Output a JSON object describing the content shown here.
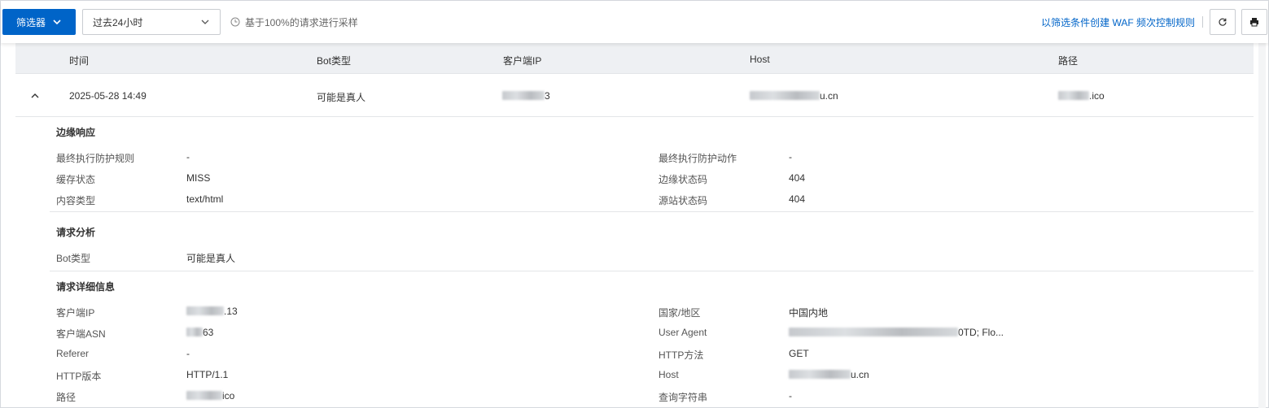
{
  "toolbar": {
    "filter_label": "筛选器",
    "time_range": "过去24小时",
    "sampling_note": "基于100%的请求进行采样",
    "waf_link": "以筛选条件创建 WAF 频次控制规则"
  },
  "table": {
    "columns": [
      "时间",
      "Bot类型",
      "客户端IP",
      "Host",
      "路径"
    ],
    "row": {
      "time": "2025-05-28 14:49",
      "bot_type": "可能是真人",
      "client_ip_suffix": "3",
      "host_suffix": "u.cn",
      "path_suffix": ".ico"
    }
  },
  "sections": {
    "edge": {
      "title": "边缘响应",
      "final_rule_label": "最终执行防护规则",
      "final_rule_value": "-",
      "final_action_label": "最终执行防护动作",
      "final_action_value": "-",
      "cache_label": "缓存状态",
      "cache_value": "MISS",
      "edge_code_label": "边缘状态码",
      "edge_code_value": "404",
      "content_type_label": "内容类型",
      "content_type_value": "text/html",
      "origin_code_label": "源站状态码",
      "origin_code_value": "404"
    },
    "analysis": {
      "title": "请求分析",
      "bot_label": "Bot类型",
      "bot_value": "可能是真人"
    },
    "details": {
      "title": "请求详细信息",
      "client_ip_label": "客户端IP",
      "client_ip_suffix": ".13",
      "country_label": "国家/地区",
      "country_value": "中国内地",
      "asn_label": "客户端ASN",
      "asn_suffix": "63",
      "ua_label": "User Agent",
      "ua_suffix": "0TD; Flo...",
      "referer_label": "Referer",
      "referer_value": "-",
      "method_label": "HTTP方法",
      "method_value": "GET",
      "version_label": "HTTP版本",
      "version_value": "HTTP/1.1",
      "host_label": "Host",
      "host_suffix": "u.cn",
      "path_label": "路径",
      "path_suffix": "ico",
      "query_label": "查询字符串",
      "query_value": "-"
    }
  },
  "colors": {
    "primary": "#0064c8",
    "header_bg": "#eef0f3"
  }
}
